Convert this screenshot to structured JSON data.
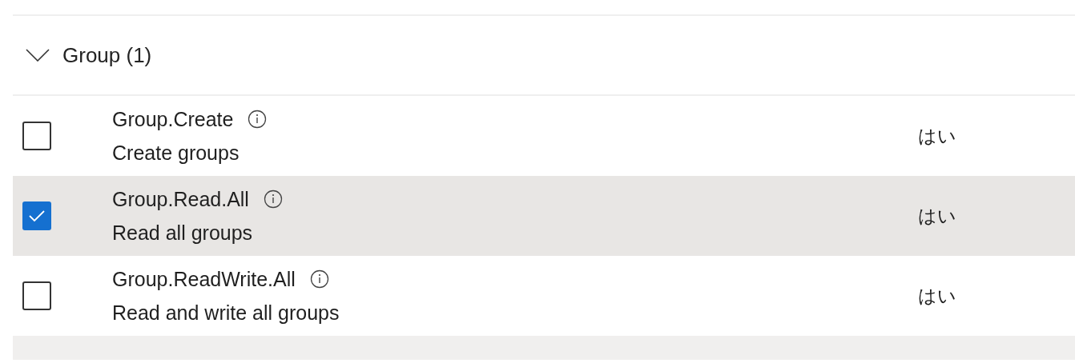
{
  "group": {
    "title": "Group (1)",
    "expanded": true
  },
  "permissions": [
    {
      "name": "Group.Create",
      "description": "Create groups",
      "admin_consent": "はい",
      "checked": false
    },
    {
      "name": "Group.Read.All",
      "description": "Read all groups",
      "admin_consent": "はい",
      "checked": true
    },
    {
      "name": "Group.ReadWrite.All",
      "description": "Read and write all groups",
      "admin_consent": "はい",
      "checked": false
    }
  ]
}
